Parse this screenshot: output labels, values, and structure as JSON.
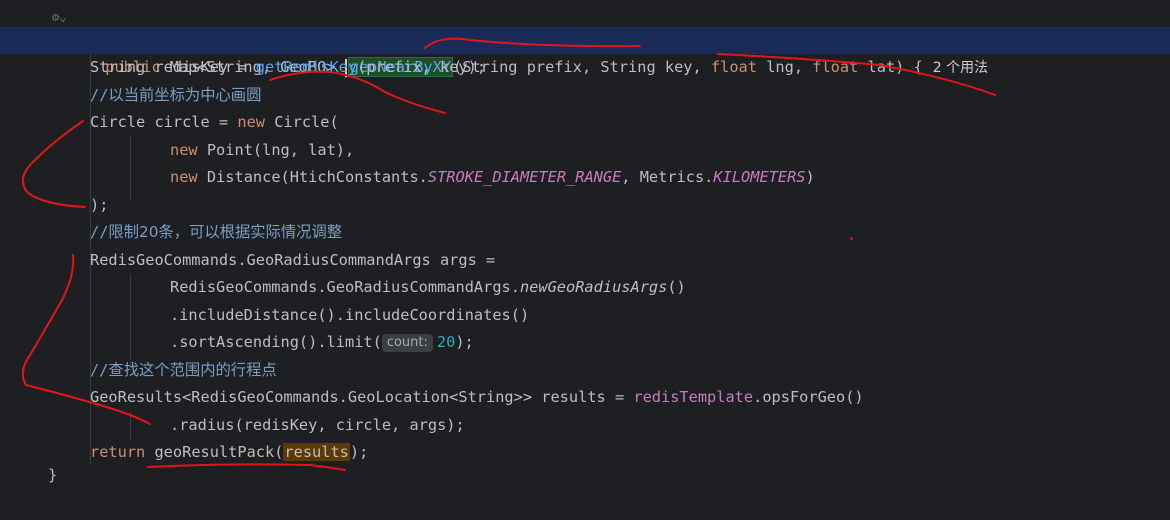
{
  "gutter": {
    "fold_icon": "fold-chevron-icon"
  },
  "usages_hint": "2 个用法",
  "inlay_hint": "count:",
  "lines": {
    "l1": {
      "kw_public": "public",
      "type_map": " Map<String, GeoBO> ",
      "method": "geoNearByXY",
      "params_a": "(String prefix, String key, ",
      "kw_float1": "float",
      "p_lng": " lng, ",
      "kw_float2": "float",
      "p_lat": " lat) {"
    },
    "l2": {
      "a": "String redisKey = ",
      "fn": "getRedisKey",
      "b": "(prefix, key);"
    },
    "l3": {
      "slashes": "//",
      "text": "以当前坐标为中心画圆"
    },
    "l4": {
      "a": "Circle circle = ",
      "kw": "new",
      "b": " Circle("
    },
    "l5": {
      "kw": "new",
      "b": " Point(lng, lat),"
    },
    "l6": {
      "kw": "new",
      "b": " Distance(HtichConstants.",
      "const1": "STROKE_DIAMETER_RANGE",
      "c": ", Metrics.",
      "const2": "KILOMETERS",
      "d": ")"
    },
    "l7": {
      "a": ");"
    },
    "l8": {
      "slashes": "//",
      "text": "限制20条，可以根据实际情况调整"
    },
    "l9": {
      "a": "RedisGeoCommands.GeoRadiusCommandArgs args ="
    },
    "l10": {
      "a": "RedisGeoCommands.GeoRadiusCommandArgs.",
      "it": "newGeoRadiusArgs",
      "b": "()"
    },
    "l11": {
      "a": ".includeDistance().includeCoordinates()"
    },
    "l12": {
      "a": ".sortAscending().limit(",
      "num": "20",
      "b": ");"
    },
    "l13": {
      "slashes": "//",
      "text": "查找这个范围内的行程点"
    },
    "l14": {
      "a": "GeoResults<RedisGeoCommands.GeoLocation<String>> results = ",
      "prop": "redisTemplate",
      "b": ".opsForGeo()"
    },
    "l15": {
      "a": ".radius(redisKey, circle, args);"
    },
    "l16": {
      "kw": "return",
      "a": " geoResultPack(",
      "var": "results",
      "b": ");"
    },
    "l17": {
      "a": "}"
    }
  },
  "annotation_color": "#e0161b"
}
